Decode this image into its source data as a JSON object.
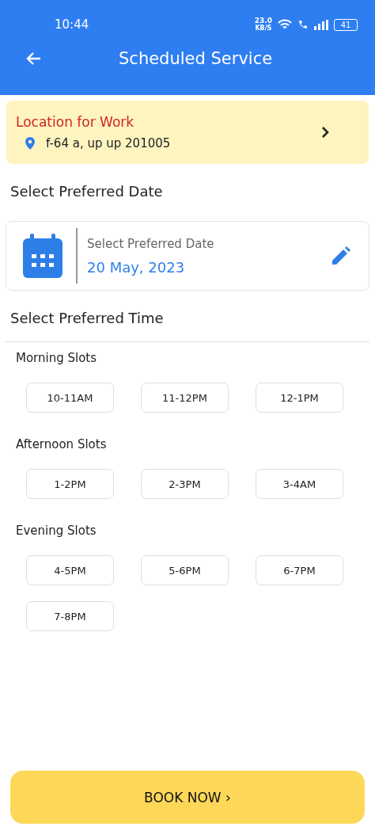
{
  "status_bar": {
    "time": "10:44",
    "speed": "23.0",
    "speed_unit": "KB/S",
    "battery": "41"
  },
  "header": {
    "title": "Scheduled Service"
  },
  "location": {
    "title": "Location for Work",
    "address": "f-64  a, up up 201005"
  },
  "date_section": {
    "heading": "Select Preferred Date",
    "label": "Select Preferred Date",
    "value": "20 May, 2023"
  },
  "time_section": {
    "heading": "Select Preferred Time",
    "groups": [
      {
        "title": "Morning Slots",
        "slots": [
          {
            "label": "10-11AM",
            "selected": false
          },
          {
            "label": "11-12PM",
            "selected": false
          },
          {
            "label": "12-1PM",
            "selected": false
          }
        ]
      },
      {
        "title": "Afternoon Slots",
        "slots": [
          {
            "label": "1-2PM",
            "selected": false
          },
          {
            "label": "2-3PM",
            "selected": false
          },
          {
            "label": "3-4AM",
            "selected": false
          }
        ]
      },
      {
        "title": "Evening Slots",
        "slots": [
          {
            "label": "4-5PM",
            "selected": false
          },
          {
            "label": "5-6PM",
            "selected": false
          },
          {
            "label": "6-7PM",
            "selected": false
          },
          {
            "label": "7-8PM",
            "selected": false
          }
        ]
      }
    ]
  },
  "book_button": {
    "label": "BOOK NOW ›"
  }
}
